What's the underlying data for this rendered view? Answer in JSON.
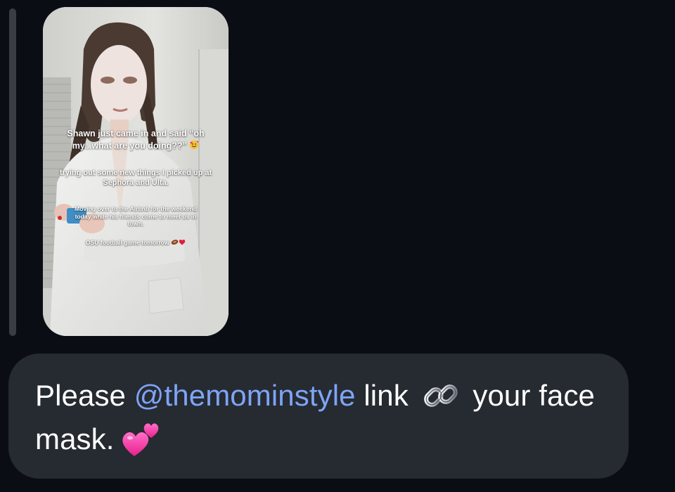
{
  "story": {
    "caption_1": "Shawn just came in and said “oh my...what are you doing??”",
    "caption_2": "trying out some new things I picked up at Sephora and Ulta.",
    "caption_3": "Moving over to the Airbnb for the weekend today while his friends come to meet us in town.",
    "caption_4": "OSU football game tomorrow",
    "caption_1_emoji_icon": "smiling-face-with-hearts-icon",
    "caption_4_emoji_icons": [
      "football-icon",
      "red-heart-icon"
    ]
  },
  "message": {
    "text_before": "Please ",
    "mention": "@themominstyle",
    "text_middle": " link ",
    "link_icon": "link-icon",
    "text_after": " your face mask.",
    "hearts_icon": "two-hearts-icon"
  },
  "colors": {
    "background": "#0a0d13",
    "bubble": "#262a31",
    "mention": "#7ea4f5",
    "text": "#ffffff"
  }
}
